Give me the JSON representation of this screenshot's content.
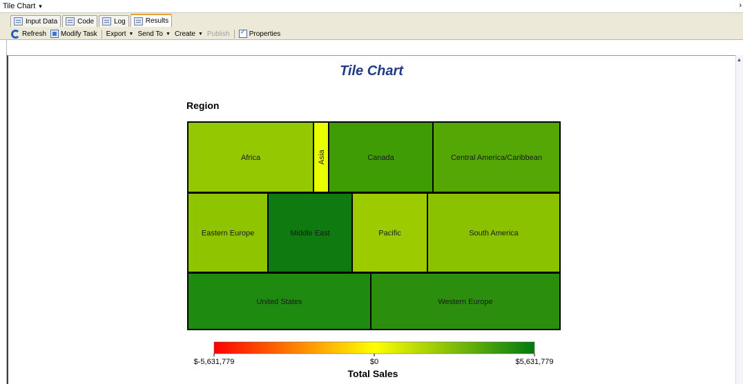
{
  "window": {
    "title": "Tile Chart",
    "title_caret": "▾",
    "scroll_right": "›"
  },
  "tabs": [
    {
      "label": "Input Data",
      "active": false
    },
    {
      "label": "Code",
      "active": false
    },
    {
      "label": "Log",
      "active": false
    },
    {
      "label": "Results",
      "active": true
    }
  ],
  "toolbar": {
    "refresh": "Refresh",
    "modify_task": "Modify Task",
    "export": "Export",
    "send_to": "Send To",
    "create": "Create",
    "publish": "Publish",
    "properties": "Properties"
  },
  "chart_data": {
    "type": "tile",
    "title": "Tile Chart",
    "group_label": "Region",
    "tiles": [
      {
        "label": "Africa",
        "color": "#94c800"
      },
      {
        "label": "Asia",
        "color": "#e9ff00",
        "vertical": true
      },
      {
        "label": "Canada",
        "color": "#3f9c05"
      },
      {
        "label": "Central America/Caribbean",
        "color": "#55a705"
      },
      {
        "label": "Eastern Europe",
        "color": "#8ec400"
      },
      {
        "label": "Middle East",
        "color": "#0f7a10"
      },
      {
        "label": "Pacific",
        "color": "#9ccc00"
      },
      {
        "label": "South America",
        "color": "#8bc200"
      },
      {
        "label": "United States",
        "color": "#1f8a10"
      },
      {
        "label": "Western Europe",
        "color": "#2b8e0d"
      }
    ],
    "color_scale": {
      "min_label": "$-5,631,779",
      "mid_label": "$0",
      "max_label": "$5,631,779",
      "min": -5631779,
      "max": 5631779,
      "colors": [
        "#ff0000",
        "#ffff00",
        "#007a10"
      ],
      "axis_label": "Total Sales"
    }
  }
}
